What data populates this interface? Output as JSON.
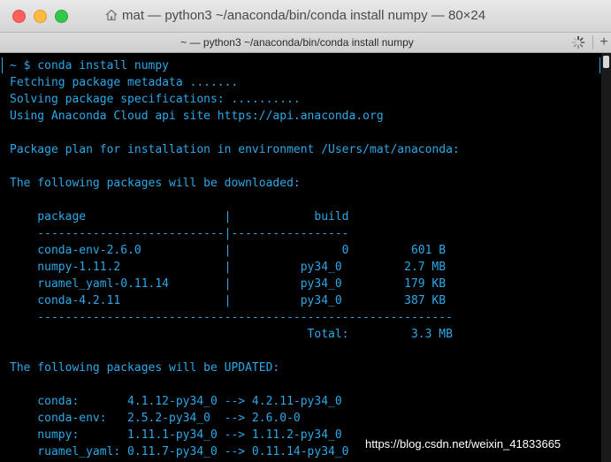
{
  "window": {
    "title": "mat — python3 ~/anaconda/bin/conda install numpy — 80×24",
    "tab_title": "~ — python3 ~/anaconda/bin/conda install numpy",
    "new_tab_label": "+"
  },
  "terminal": {
    "lines": [
      "~ $ conda install numpy",
      "Fetching package metadata .......",
      "Solving package specifications: ..........",
      "Using Anaconda Cloud api site https://api.anaconda.org",
      "",
      "Package plan for installation in environment /Users/mat/anaconda:",
      "",
      "The following packages will be downloaded:",
      "",
      "    package                    |            build",
      "    ---------------------------|-----------------",
      "    conda-env-2.6.0            |                0         601 B",
      "    numpy-1.11.2               |          py34_0         2.7 MB",
      "    ruamel_yaml-0.11.14        |          py34_0         179 KB",
      "    conda-4.2.11               |          py34_0         387 KB",
      "    ------------------------------------------------------------",
      "                                           Total:         3.3 MB",
      "",
      "The following packages will be UPDATED:",
      "",
      "    conda:       4.1.12-py34_0 --> 4.2.11-py34_0",
      "    conda-env:   2.5.2-py34_0  --> 2.6.0-0",
      "    numpy:       1.11.1-py34_0 --> 1.11.2-py34_0",
      "    ruamel_yaml: 0.11.7-py34_0 --> 0.11.14-py34_0"
    ],
    "text_color": "#2ea8e6",
    "background": "#000000"
  },
  "watermark": "https://blog.csdn.net/weixin_41833665",
  "icons": {
    "home": "home-icon",
    "spinner": "spinner-icon"
  }
}
